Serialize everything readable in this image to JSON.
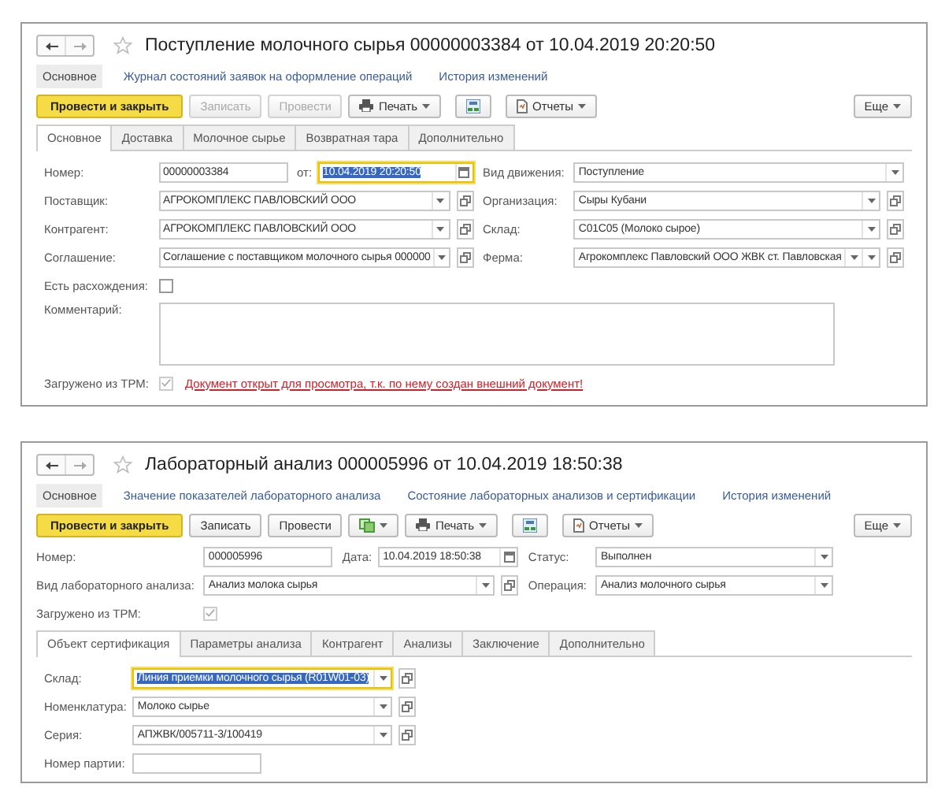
{
  "documents": [
    {
      "title": "Поступление молочного сырья 00000003384 от 10.04.2019 20:20:50",
      "sections": [
        {
          "label": "Основное",
          "selected": true
        },
        {
          "label": "Журнал состояний заявок на оформление операций",
          "selected": false
        },
        {
          "label": "История изменений",
          "selected": false
        }
      ],
      "toolbar": [
        {
          "kind": "primary",
          "label": "Провести и закрыть"
        },
        {
          "kind": "button",
          "label": "Записать",
          "disabled": true
        },
        {
          "kind": "button",
          "label": "Провести",
          "disabled": true
        },
        {
          "kind": "print-menu",
          "label": "Печать"
        },
        {
          "kind": "structure"
        },
        {
          "kind": "reports-menu",
          "label": "Отчеты"
        }
      ],
      "more_button": "Еще",
      "blocks": [
        {
          "kind": "tabs",
          "tabs": [
            {
              "label": "Основное",
              "selected": true
            },
            {
              "label": "Доставка",
              "selected": false
            },
            {
              "label": "Молочное сырье",
              "selected": false
            },
            {
              "label": "Возвратная тара",
              "selected": false
            },
            {
              "label": "Дополнительно",
              "selected": false
            }
          ]
        },
        {
          "kind": "form",
          "rows": [
            {
              "kind": "pair",
              "cells": [
                {
                  "label": "Номер:",
                  "fields": [
                    {
                      "kind": "number",
                      "value": "00000003384"
                    },
                    {
                      "kind": "caption",
                      "text": "от:"
                    },
                    {
                      "kind": "date",
                      "value": "10.04.2019 20:20:50",
                      "focused": true
                    }
                  ]
                },
                {
                  "label": "Вид движения:",
                  "fields": [
                    {
                      "kind": "select",
                      "value": "Поступление"
                    }
                  ]
                }
              ]
            },
            {
              "kind": "pair",
              "cells": [
                {
                  "label": "Поставщик:",
                  "fields": [
                    {
                      "kind": "reference",
                      "value": "АГРОКОМПЛЕКС ПАВЛОВСКИЙ ООО"
                    }
                  ]
                },
                {
                  "label": "Организация:",
                  "fields": [
                    {
                      "kind": "reference",
                      "value": "Сыры Кубани"
                    }
                  ]
                }
              ]
            },
            {
              "kind": "pair",
              "cells": [
                {
                  "label": "Контрагент:",
                  "fields": [
                    {
                      "kind": "reference",
                      "value": "АГРОКОМПЛЕКС ПАВЛОВСКИЙ ООО"
                    }
                  ]
                },
                {
                  "label": "Склад:",
                  "fields": [
                    {
                      "kind": "reference",
                      "value": "С01С05 (Молоко сырое)"
                    }
                  ]
                }
              ]
            },
            {
              "kind": "pair",
              "cells": [
                {
                  "label": "Соглашение:",
                  "fields": [
                    {
                      "kind": "reference",
                      "value": "Соглашение с поставщиком молочного сырья 000000"
                    }
                  ]
                },
                {
                  "label": "Ферма:",
                  "fields": [
                    {
                      "kind": "reference-choice",
                      "value": "Агрокомплекс Павловский ООО ЖВК ст. Павловская"
                    }
                  ]
                }
              ]
            },
            {
              "kind": "pair",
              "cells": [
                {
                  "label": "Есть расхождения:",
                  "fields": [
                    {
                      "kind": "checkbox",
                      "checked": false,
                      "disabled": false
                    }
                  ]
                }
              ]
            },
            {
              "kind": "wide",
              "cells": [
                {
                  "label": "Комментарий:",
                  "fields": [
                    {
                      "kind": "textarea"
                    }
                  ]
                }
              ]
            },
            {
              "kind": "wide",
              "cells": [
                {
                  "label": "Загружено из ТРМ:",
                  "fields": [
                    {
                      "kind": "checkbox",
                      "checked": true,
                      "disabled": true
                    },
                    {
                      "kind": "warning",
                      "text": "Документ открыт для просмотра, т.к. по нему создан внешний документ!"
                    }
                  ]
                }
              ]
            }
          ]
        }
      ]
    },
    {
      "title": "Лабораторный анализ 000005996 от 10.04.2019 18:50:38",
      "sections": [
        {
          "label": "Основное",
          "selected": true
        },
        {
          "label": "Значение показателей лабораторного анализа",
          "selected": false
        },
        {
          "label": "Состояние лабораторных анализов и сертификации",
          "selected": false
        },
        {
          "label": "История изменений",
          "selected": false
        }
      ],
      "toolbar": [
        {
          "kind": "primary",
          "label": "Провести и закрыть"
        },
        {
          "kind": "button",
          "label": "Записать",
          "disabled": false
        },
        {
          "kind": "button",
          "label": "Провести",
          "disabled": false
        },
        {
          "kind": "create-menu"
        },
        {
          "kind": "print-menu",
          "label": "Печать"
        },
        {
          "kind": "structure"
        },
        {
          "kind": "reports-menu",
          "label": "Отчеты"
        }
      ],
      "more_button": "Еще",
      "blocks": [
        {
          "kind": "form",
          "rows": [
            {
              "kind": "pair",
              "cells": [
                {
                  "label": "Номер:",
                  "fields": [
                    {
                      "kind": "number",
                      "value": "000005996"
                    },
                    {
                      "kind": "caption",
                      "text": "Дата:"
                    },
                    {
                      "kind": "date",
                      "value": "10.04.2019 18:50:38",
                      "focused": false
                    }
                  ]
                },
                {
                  "label": "Статус:",
                  "fields": [
                    {
                      "kind": "select",
                      "value": "Выполнен"
                    }
                  ]
                }
              ]
            },
            {
              "kind": "pair",
              "cells": [
                {
                  "label": "Вид лабораторного анализа:",
                  "fields": [
                    {
                      "kind": "reference",
                      "value": "Анализ молока сырья"
                    }
                  ]
                },
                {
                  "label": "Операция:",
                  "fields": [
                    {
                      "kind": "select",
                      "value": "Анализ молочного сырья"
                    }
                  ]
                }
              ]
            },
            {
              "kind": "pair",
              "cells": [
                {
                  "label": "Загружено из ТРМ:",
                  "fields": [
                    {
                      "kind": "checkbox",
                      "checked": true,
                      "disabled": true
                    }
                  ]
                }
              ]
            }
          ]
        },
        {
          "kind": "tabs",
          "tabs": [
            {
              "label": "Объект сертификация",
              "selected": true
            },
            {
              "label": "Параметры анализа",
              "selected": false
            },
            {
              "label": "Контрагент",
              "selected": false
            },
            {
              "label": "Анализы",
              "selected": false
            },
            {
              "label": "Заключение",
              "selected": false
            },
            {
              "label": "Дополнительно",
              "selected": false
            }
          ]
        },
        {
          "kind": "form",
          "rows": [
            {
              "kind": "pair",
              "cells": [
                {
                  "label": "Склад:",
                  "fields": [
                    {
                      "kind": "reference",
                      "value": "Линия приемки молочного сырья (R01W01-03)",
                      "focused": true
                    }
                  ]
                }
              ]
            },
            {
              "kind": "pair",
              "cells": [
                {
                  "label": "Номенклатура:",
                  "fields": [
                    {
                      "kind": "reference",
                      "value": "Молоко сырье"
                    }
                  ]
                }
              ]
            },
            {
              "kind": "pair",
              "cells": [
                {
                  "label": "Серия:",
                  "fields": [
                    {
                      "kind": "reference",
                      "value": "АПЖВК/005711-3/100419"
                    }
                  ]
                }
              ]
            },
            {
              "kind": "pair",
              "cells": [
                {
                  "label": "Номер партии:",
                  "fields": [
                    {
                      "kind": "number"
                    }
                  ]
                }
              ]
            }
          ]
        }
      ]
    }
  ]
}
